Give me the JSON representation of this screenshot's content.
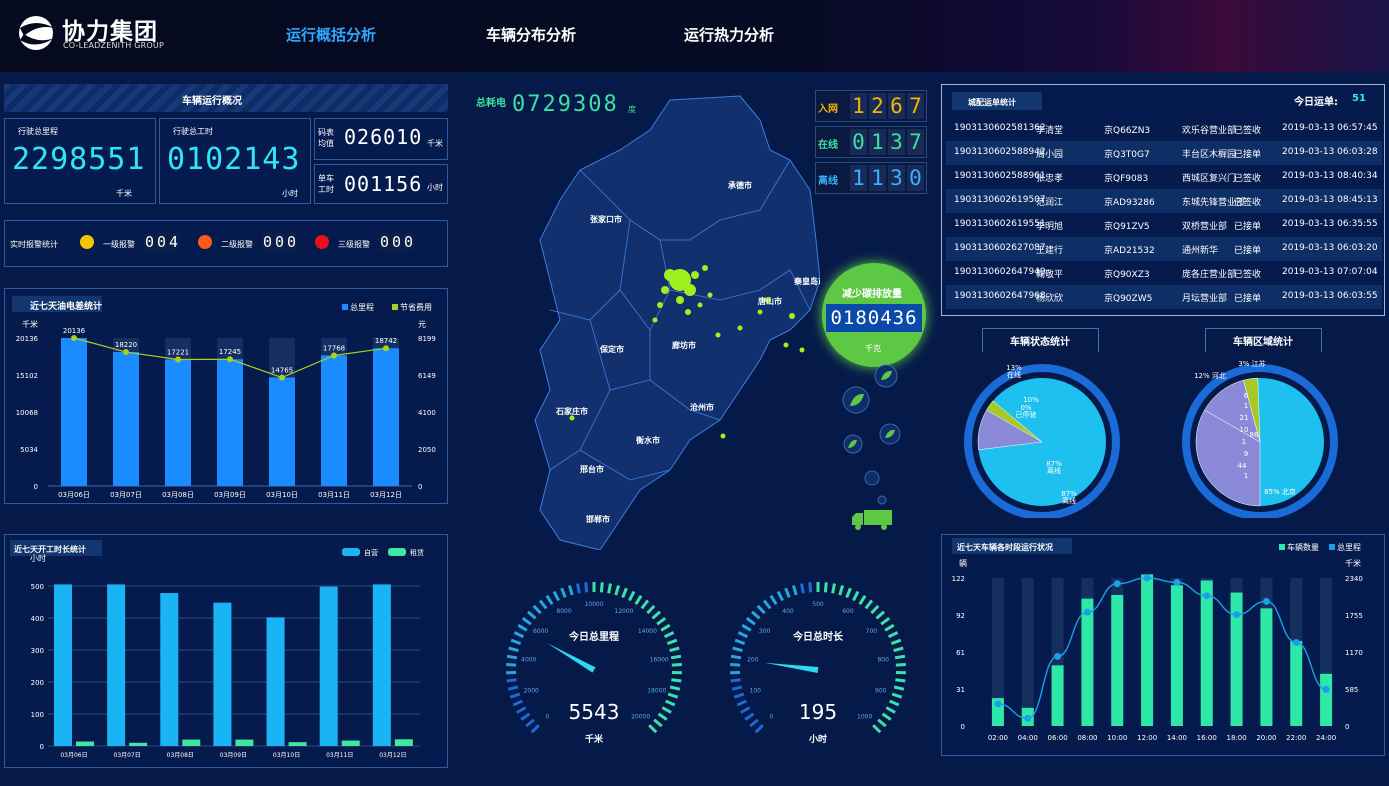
{
  "header": {
    "logo_cn": "协力集团",
    "logo_en": "CO-LEADZENITH GROUP",
    "nav": [
      "运行概括分析",
      "车辆分布分析",
      "运行热力分析"
    ],
    "active_color": "#2fa8ff"
  },
  "overview": {
    "title": "车辆运行概况",
    "total_mileage_label": "行驶总里程",
    "total_mileage": "2298551",
    "total_mileage_unit": "千米",
    "total_hours_label": "行驶总工时",
    "total_hours": "0102143",
    "total_hours_unit": "小时",
    "meter_avg_label1": "码表",
    "meter_avg_label2": "均值",
    "meter_avg": "026010",
    "meter_avg_unit": "千米",
    "single_hours_label1": "单车",
    "single_hours_label2": "工时",
    "single_hours": "001156",
    "single_hours_unit": "小时"
  },
  "alarms": {
    "title": "实时报警统计",
    "items": [
      {
        "label": "一级报警",
        "value": "004",
        "color": "#f5c400"
      },
      {
        "label": "二级报警",
        "value": "000",
        "color": "#ff5a1a"
      },
      {
        "label": "三级报警",
        "value": "000",
        "color": "#e8101a"
      }
    ]
  },
  "map": {
    "power_label": "总耗电",
    "power_value": "0729308",
    "power_unit": "度",
    "cities": [
      "承德市",
      "张家口市",
      "唐山市",
      "秦皇岛市",
      "保定市",
      "廊坊市",
      "沧州市",
      "石家庄市",
      "衡水市",
      "邢台市",
      "邯郸市"
    ],
    "status": [
      {
        "label": "入网",
        "value": "1267",
        "color": "#f5b400"
      },
      {
        "label": "在线",
        "value": "0137",
        "color": "#3ee0a0"
      },
      {
        "label": "离线",
        "value": "1130",
        "color": "#3ab0ff"
      }
    ],
    "carbon_title": "减少碳排放量",
    "carbon_value": "0180436",
    "carbon_unit": "千克"
  },
  "gauges": [
    {
      "title": "今日总里程",
      "value": "5543",
      "unit": "千米",
      "max": 20000,
      "ticks": [
        "0",
        "2000",
        "4000",
        "6000",
        "8000",
        "10000",
        "12000",
        "14000",
        "16000",
        "18000",
        "20000"
      ],
      "level": 0.277
    },
    {
      "title": "今日总时长",
      "value": "195",
      "unit": "小时",
      "max": 1000,
      "ticks": [
        "0",
        "100",
        "200",
        "300",
        "400",
        "500",
        "600",
        "700",
        "800",
        "900",
        "1000"
      ],
      "level": 0.195
    }
  ],
  "orders": {
    "title": "城配运单统计",
    "today_label": "今日运单:",
    "today_value": "51",
    "rows": [
      [
        "1903130602581362",
        "李清堂",
        "京Q66ZN3",
        "欢乐谷营业部",
        "已签收",
        "2019-03-13 06:57:45"
      ],
      [
        "1903130602588942",
        "周小园",
        "京Q3T0G7",
        "丰台区木樨园",
        "已接单",
        "2019-03-13 06:03:28"
      ],
      [
        "1903130602588961",
        "张忠孝",
        "京QF9083",
        "西城区复兴门",
        "已签收",
        "2019-03-13 08:40:34"
      ],
      [
        "1903130602619507",
        "范润江",
        "京AD93286",
        "东城先锋营业部",
        "已签收",
        "2019-03-13 08:45:13"
      ],
      [
        "1903130602619551",
        "李明旭",
        "京Q91ZV5",
        "双桥营业部",
        "已接单",
        "2019-03-13 06:35:55"
      ],
      [
        "1903130602627087",
        "王建行",
        "京AD21532",
        "通州新华",
        "已接单",
        "2019-03-13 06:03:20"
      ],
      [
        "1903130602647949",
        "鞠敬平",
        "京Q90XZ3",
        "庞各庄营业部",
        "已签收",
        "2019-03-13 07:07:04"
      ],
      [
        "1903130602647968",
        "杨欣欣",
        "京Q90ZW5",
        "月坛营业部",
        "已接单",
        "2019-03-13 06:03:55"
      ]
    ]
  },
  "chart_data": [
    {
      "type": "bar",
      "title": "近七天油电差统计",
      "categories": [
        "03月06日",
        "03月07日",
        "03月08日",
        "03月09日",
        "03月10日",
        "03月11日",
        "03月12日"
      ],
      "series": [
        {
          "name": "总里程",
          "values": [
            20136,
            18220,
            17221,
            17245,
            14765,
            17768,
            18742
          ],
          "color": "#1a8cff"
        },
        {
          "name": "节省费用",
          "values": [
            8199,
            7420,
            7010,
            7020,
            6010,
            7230,
            7630
          ],
          "color": "#a8d020"
        }
      ],
      "ylabel_left": "千米",
      "ylabel_right": "元",
      "yticks_left": [
        "20136",
        "15102",
        "10068",
        "5034",
        "0"
      ],
      "yticks_right": [
        "8199",
        "6149",
        "4100",
        "2050",
        "0"
      ],
      "ylim_left": [
        0,
        20136
      ],
      "ylim_right": [
        0,
        8199
      ],
      "legend": "top-right"
    },
    {
      "type": "bar",
      "title": "近七天开工时长统计",
      "categories": [
        "03月06日",
        "03月07日",
        "03月08日",
        "03月09日",
        "03月10日",
        "03月11日",
        "03月12日"
      ],
      "series": [
        {
          "name": "自营",
          "values": [
            505,
            505,
            478,
            448,
            402,
            498,
            505
          ],
          "color": "#1ab4f5"
        },
        {
          "name": "租赁",
          "values": [
            14,
            10,
            20,
            20,
            12,
            17,
            21
          ],
          "color": "#3fe8a0"
        }
      ],
      "ylabel": "小时",
      "yticks": [
        "500",
        "400",
        "300",
        "200",
        "100",
        "0"
      ],
      "ylim": [
        0,
        500
      ],
      "legend": "top-right"
    },
    {
      "type": "pie",
      "title": "车辆状态统计",
      "labels": [
        {
          "text": "13%",
          "sub": "在线"
        },
        {
          "text": "10%",
          "sub": ""
        },
        {
          "text": "0%",
          "sub": "已停驶"
        },
        {
          "text": "87%",
          "sub": "离线"
        },
        {
          "text": "87%",
          "sub": "离线"
        }
      ],
      "slices": [
        {
          "name": "在线",
          "value": 13,
          "color": "#a8c828"
        },
        {
          "name": "离线",
          "value": 87,
          "color": "#1ec0f0"
        }
      ]
    },
    {
      "type": "pie",
      "title": "车辆区域统计",
      "labels": [
        "12% 河北",
        "3% 江苏",
        "6",
        "1",
        "21",
        "10",
        "1",
        "86",
        "9",
        "44",
        "1",
        "85% 北京"
      ],
      "slices": [
        {
          "name": "北京",
          "value": 85,
          "color": "#1ec0f0"
        },
        {
          "name": "其他",
          "value": 44,
          "color": "#8a8ad8"
        },
        {
          "name": "河北",
          "value": 12,
          "color": "#a8c828"
        }
      ]
    },
    {
      "type": "bar",
      "title": "近七天车辆各时段运行状况",
      "categories": [
        "02:00",
        "04:00",
        "06:00",
        "08:00",
        "10:00",
        "12:00",
        "14:00",
        "16:00",
        "18:00",
        "20:00",
        "22:00",
        "24:00"
      ],
      "series": [
        {
          "name": "车辆数量",
          "values": [
            23,
            15,
            50,
            105,
            108,
            125,
            116,
            120,
            110,
            97,
            70,
            43
          ],
          "color": "#2ee8a8"
        },
        {
          "name": "总里程",
          "values": [
            350,
            120,
            1100,
            1800,
            2250,
            2340,
            2270,
            2060,
            1760,
            1970,
            1320,
            580
          ],
          "color": "#1aa0e8"
        }
      ],
      "ylabel_left": "辆",
      "ylabel_right": "千米",
      "yticks_left": [
        "122",
        "92",
        "61",
        "31",
        "0"
      ],
      "yticks_right": [
        "2340",
        "1755",
        "1170",
        "585",
        "0"
      ],
      "ylim_left": [
        0,
        122
      ],
      "ylim_right": [
        0,
        2340
      ],
      "legend": "top-right"
    }
  ]
}
